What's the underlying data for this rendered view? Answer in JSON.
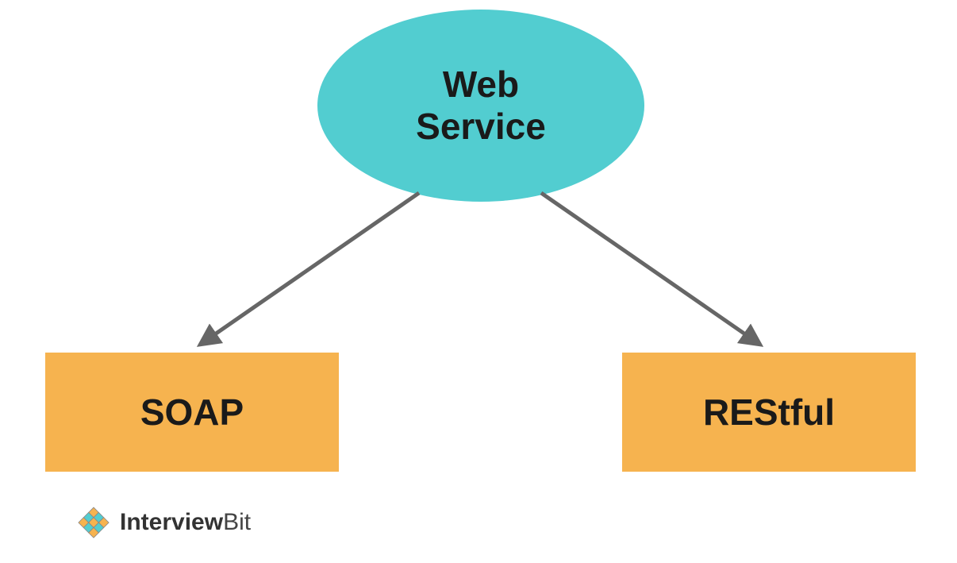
{
  "diagram": {
    "root": {
      "line1": "Web",
      "line2": "Service"
    },
    "children": [
      {
        "label": "SOAP"
      },
      {
        "label": "REStful"
      }
    ]
  },
  "branding": {
    "name_part1": "Interview",
    "name_part2": "Bit"
  },
  "colors": {
    "ellipse": "#52cdd0",
    "box": "#f6b34f",
    "arrow": "#666666",
    "text": "#1a1a1a"
  }
}
